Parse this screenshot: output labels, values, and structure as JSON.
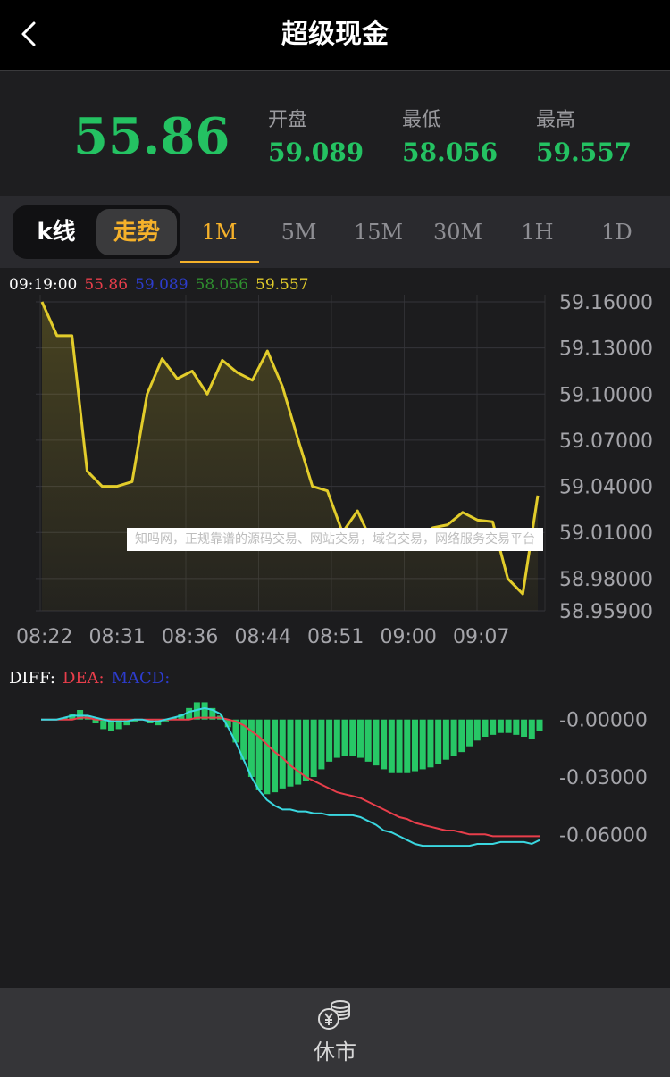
{
  "header": {
    "title": "超级现金",
    "back_icon": "chevron-left-icon"
  },
  "quote": {
    "price": "55.86",
    "open_label": "开盘",
    "open_value": "59.089",
    "low_label": "最低",
    "low_value": "58.056",
    "high_label": "最高",
    "high_value": "59.557",
    "color": "#24c262"
  },
  "tabs": {
    "kline_label": "k线",
    "trend_label": "走势",
    "intervals": [
      "1M",
      "5M",
      "15M",
      "30M",
      "1H",
      "1D"
    ],
    "active_interval": "1M"
  },
  "info_bar": {
    "time": "09:19:00",
    "v1": "55.86",
    "v2": "59.089",
    "v3": "58.056",
    "v4": "59.557"
  },
  "watermark": "知吗网，正规靠谱的源码交易、网站交易，域名交易，网络服务交易平台",
  "macd_legend": {
    "diff": "DIFF:",
    "dea": "DEA:",
    "macd": "MACD:"
  },
  "chart_data": [
    {
      "type": "area",
      "x_tick_labels": [
        "08:22",
        "08:31",
        "08:36",
        "08:44",
        "08:51",
        "09:00",
        "09:07"
      ],
      "y_tick_labels": [
        "59.16000",
        "59.13000",
        "59.10000",
        "59.07000",
        "59.04000",
        "59.01000",
        "58.98000",
        "58.95900"
      ],
      "ylim": [
        58.959,
        59.16
      ],
      "grid": true,
      "series": [
        {
          "color": "#e2cc2b",
          "values": [
            59.16,
            59.138,
            59.138,
            59.05,
            59.04,
            59.04,
            59.043,
            59.1,
            59.123,
            59.11,
            59.115,
            59.1,
            59.122,
            59.114,
            59.109,
            59.128,
            59.105,
            59.072,
            59.04,
            59.037,
            59.01,
            59.024,
            59.003,
            59.0,
            59.0,
            59.004,
            59.013,
            59.015,
            59.023,
            59.018,
            59.017,
            58.98,
            58.97,
            59.034
          ]
        }
      ]
    },
    {
      "type": "bar",
      "y_tick_labels": [
        "-0.00000",
        "-0.03000",
        "-0.06000"
      ],
      "ylim": [
        -0.072,
        0.012
      ],
      "histogram": [
        0,
        0,
        0,
        0.001,
        0.003,
        0.005,
        0.002,
        -0.002,
        -0.005,
        -0.006,
        -0.005,
        -0.003,
        -0.001,
        0,
        -0.002,
        -0.003,
        -0.001,
        0.001,
        0.003,
        0.006,
        0.009,
        0.009,
        0.006,
        0.002,
        -0.004,
        -0.012,
        -0.021,
        -0.03,
        -0.037,
        -0.039,
        -0.038,
        -0.036,
        -0.035,
        -0.034,
        -0.032,
        -0.03,
        -0.026,
        -0.022,
        -0.02,
        -0.019,
        -0.019,
        -0.02,
        -0.022,
        -0.024,
        -0.026,
        -0.028,
        -0.028,
        -0.028,
        -0.027,
        -0.026,
        -0.025,
        -0.023,
        -0.021,
        -0.019,
        -0.017,
        -0.014,
        -0.011,
        -0.009,
        -0.008,
        -0.007,
        -0.007,
        -0.008,
        -0.009,
        -0.01,
        -0.006
      ],
      "dea": [
        0,
        0,
        0,
        0,
        0,
        0.001,
        0.001,
        0,
        0,
        0,
        0,
        0,
        0,
        0,
        0,
        0,
        0,
        0,
        0,
        0,
        0.001,
        0.001,
        0.001,
        0.001,
        0,
        -0.001,
        -0.003,
        -0.006,
        -0.009,
        -0.013,
        -0.017,
        -0.02,
        -0.024,
        -0.027,
        -0.03,
        -0.032,
        -0.034,
        -0.036,
        -0.038,
        -0.039,
        -0.04,
        -0.041,
        -0.043,
        -0.045,
        -0.047,
        -0.049,
        -0.051,
        -0.052,
        -0.054,
        -0.055,
        -0.056,
        -0.057,
        -0.058,
        -0.058,
        -0.059,
        -0.06,
        -0.06,
        -0.06,
        -0.061,
        -0.061,
        -0.061,
        -0.061,
        -0.061,
        -0.061,
        -0.061
      ],
      "diff": [
        0,
        0,
        0,
        0.001,
        0.002,
        0.002,
        0.002,
        0.001,
        0,
        -0.001,
        -0.001,
        -0.001,
        0,
        0,
        -0.001,
        -0.001,
        0,
        0.001,
        0.002,
        0.004,
        0.005,
        0.006,
        0.005,
        0.003,
        -0.004,
        -0.012,
        -0.021,
        -0.03,
        -0.037,
        -0.042,
        -0.045,
        -0.047,
        -0.047,
        -0.048,
        -0.048,
        -0.049,
        -0.049,
        -0.05,
        -0.05,
        -0.05,
        -0.05,
        -0.051,
        -0.053,
        -0.055,
        -0.058,
        -0.059,
        -0.061,
        -0.063,
        -0.065,
        -0.066,
        -0.066,
        -0.066,
        -0.066,
        -0.066,
        -0.066,
        -0.066,
        -0.065,
        -0.065,
        -0.065,
        -0.064,
        -0.064,
        -0.064,
        -0.064,
        -0.065,
        -0.063
      ],
      "colors": {
        "bar": "#27c766",
        "dea": "#e83e4b",
        "diff": "#3ad7e0"
      }
    }
  ],
  "bottom_bar": {
    "label": "休市",
    "icon": "coins-icon"
  }
}
